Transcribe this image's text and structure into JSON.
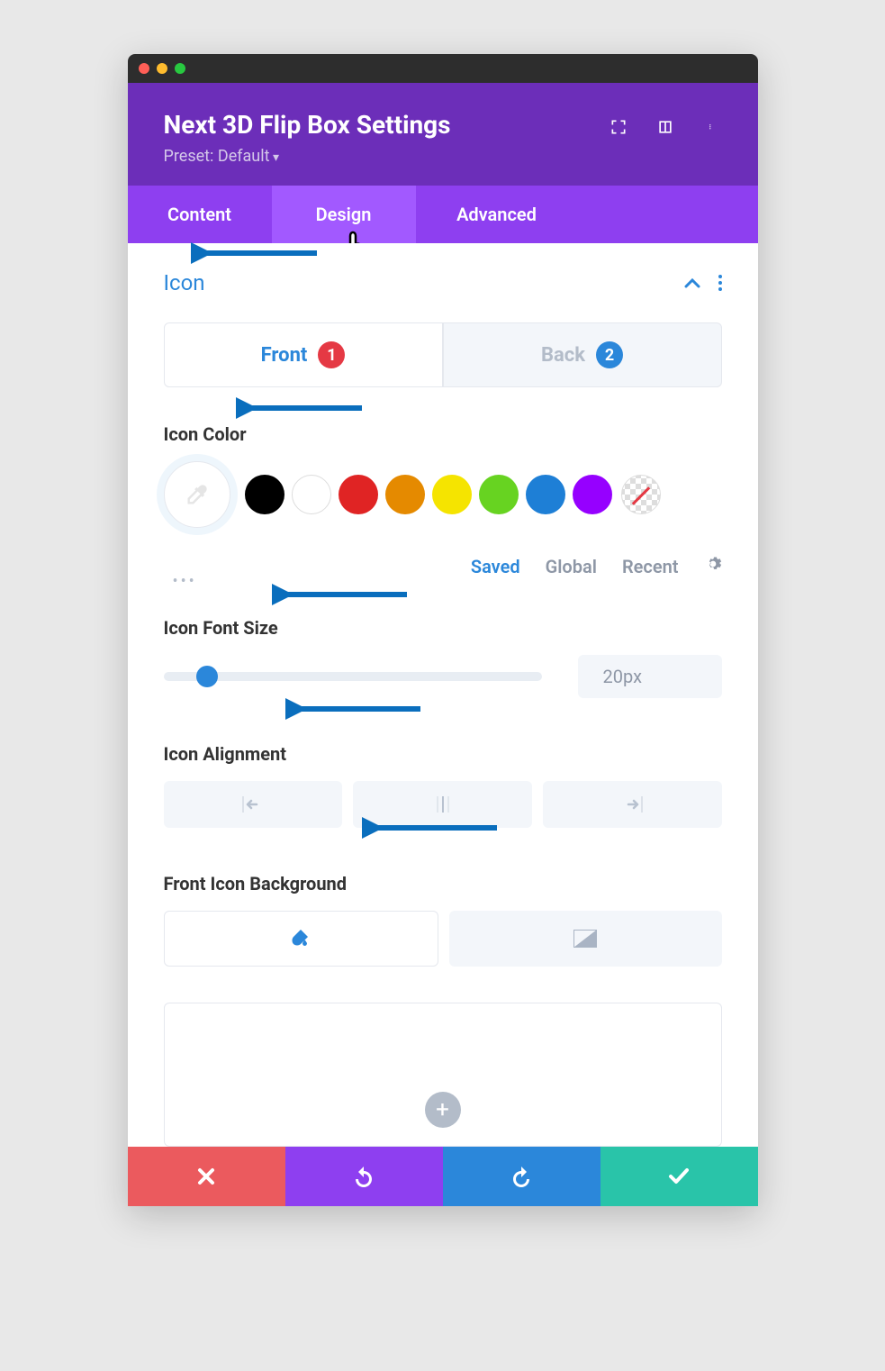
{
  "header": {
    "title": "Next 3D Flip Box Settings",
    "preset": "Preset: Default"
  },
  "tabs": {
    "content": "Content",
    "design": "Design",
    "advanced": "Advanced"
  },
  "section": {
    "title": "Icon"
  },
  "subTabs": {
    "front": "Front",
    "back": "Back",
    "frontBadge": "1",
    "backBadge": "2"
  },
  "labels": {
    "iconColor": "Icon Color",
    "iconFontSize": "Icon Font Size",
    "iconAlignment": "Icon Alignment",
    "frontIconBg": "Front Icon Background"
  },
  "swatches": [
    "#000000",
    "#ffffff",
    "#e02424",
    "#e58a00",
    "#f5e400",
    "#67d321",
    "#1e7fd6",
    "#9600ff"
  ],
  "paletteTabs": {
    "saved": "Saved",
    "global": "Global",
    "recent": "Recent"
  },
  "fontSize": "20px"
}
